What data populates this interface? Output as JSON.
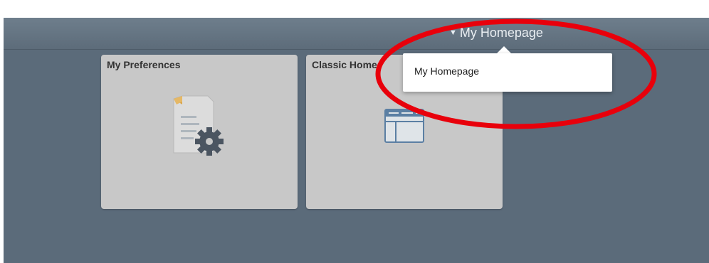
{
  "header": {
    "homepage_selector_label": "My Homepage",
    "dropdown_arrow": "▼"
  },
  "tiles": [
    {
      "title": "My Preferences",
      "icon": "preferences-document-gear-icon"
    },
    {
      "title": "Classic Home",
      "icon": "classic-window-icon"
    }
  ],
  "dropdown": {
    "items": [
      {
        "label": "My Homepage"
      }
    ]
  },
  "colors": {
    "background": "#5b6b7a",
    "tile": "#c8c8c8",
    "annotation_ring": "#e8000b"
  }
}
